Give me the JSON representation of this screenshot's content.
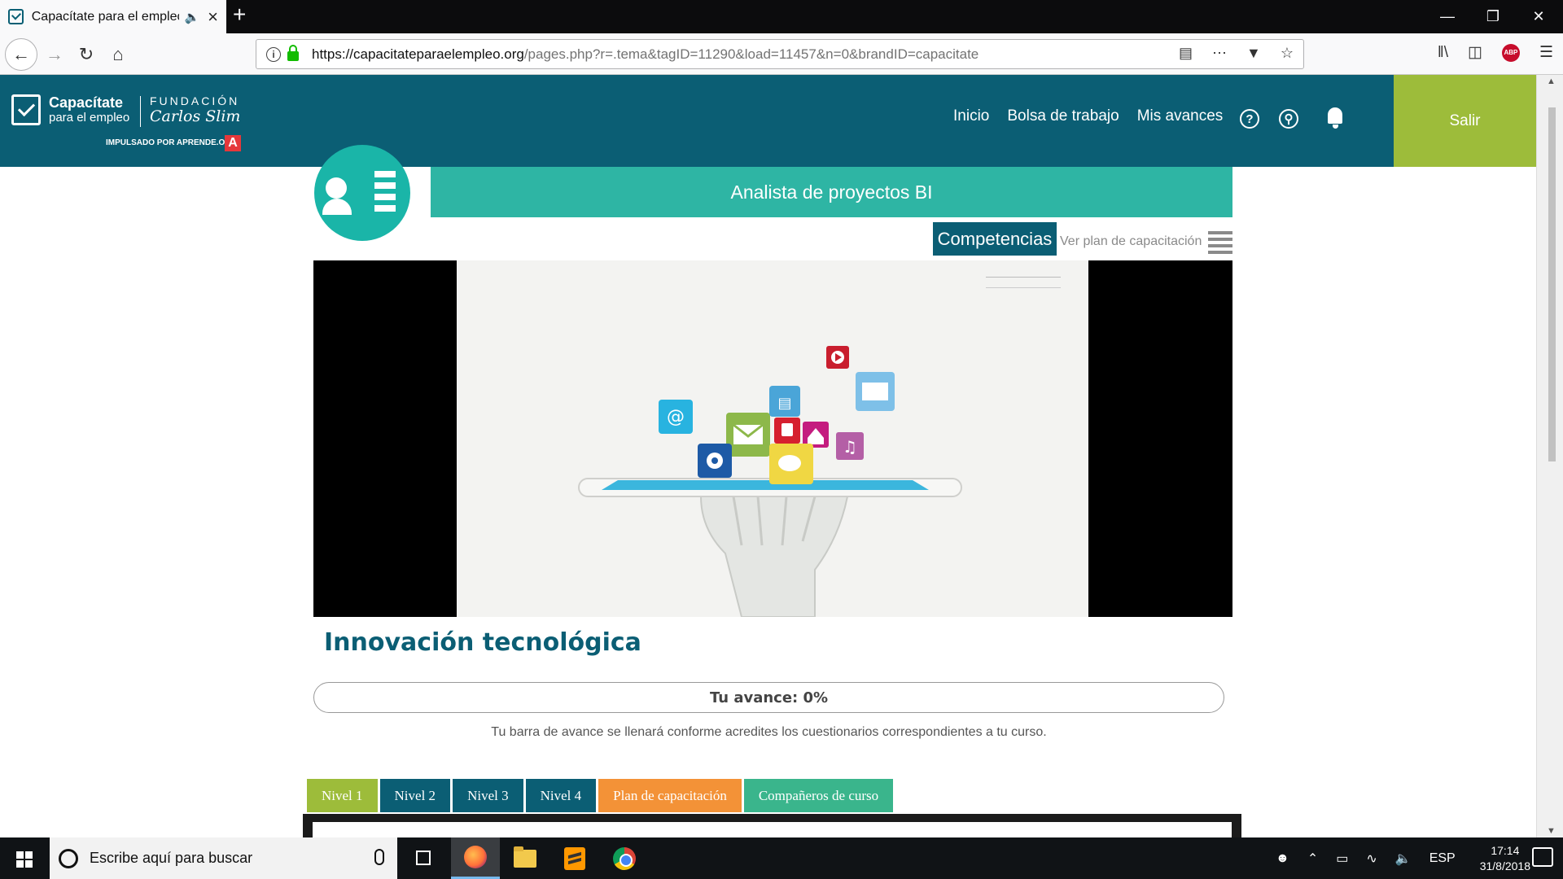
{
  "browser": {
    "tab_title": "Capacítate para el empleo",
    "new_tab": "+",
    "url_host": "https://capacitateparaelempleo.org",
    "url_path": "/pages.php?r=.tema&tagID=11290&load=11457&n=0&brandID=capacitate"
  },
  "header": {
    "logo_name": "Capacítate",
    "logo_sub": "para el empleo",
    "logo_fundacion": "FUNDACIÓN",
    "logo_carlos": "Carlos Slim",
    "logo_impulsado": "IMPULSADO POR APRENDE.ORG",
    "logo_badge": "A",
    "nav": [
      "Inicio",
      "Bolsa de trabajo",
      "Mis avances"
    ],
    "help_icon": "?",
    "logout": "Salir"
  },
  "course": {
    "banner": "Analista de proyectos BI",
    "competencias": "Competencias",
    "ver_plan": "Ver plan de capacitación",
    "title": "Innovación tecnológica",
    "progress_label": "Tu avance: 0%",
    "progress_value": 0,
    "note": "Tu barra de avance se llenará conforme acredites los cuestionarios correspondientes a tu curso.",
    "tabs": [
      {
        "label": "Nivel 1",
        "color": "#9dbc3a"
      },
      {
        "label": "Nivel 2",
        "color": "#0b5e74"
      },
      {
        "label": "Nivel 3",
        "color": "#0b5e74"
      },
      {
        "label": "Nivel 4",
        "color": "#0b5e74"
      },
      {
        "label": "Plan de capacitación",
        "color": "#f39237"
      },
      {
        "label": "Compañeros de curso",
        "color": "#3ab58c"
      }
    ]
  },
  "taskbar": {
    "search_placeholder": "Escribe aquí para buscar",
    "lang": "ESP",
    "time": "17:14",
    "date": "31/8/2018"
  },
  "colors": {
    "header": "#0b5e74",
    "accent_green": "#9dbc3a",
    "teal": "#2eb5a4"
  }
}
